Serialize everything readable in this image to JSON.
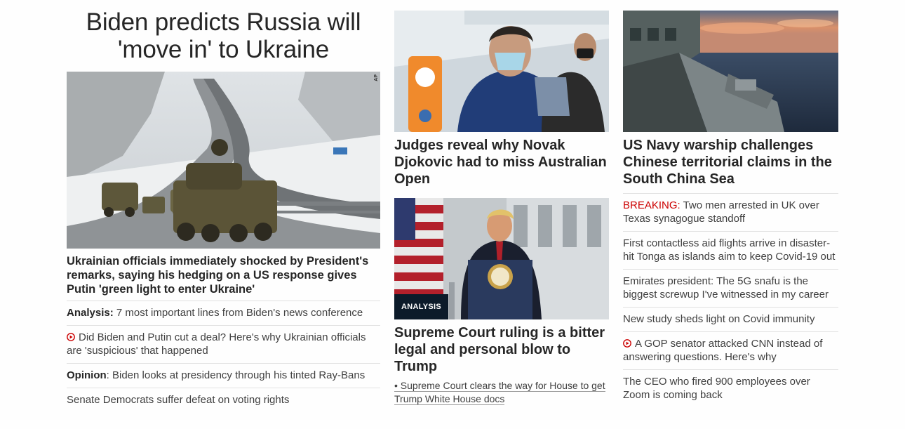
{
  "lead": {
    "title": "Biden predicts Russia will 'move in' to Ukraine",
    "image_credit": "AP",
    "caption": "Ukrainian officials immediately shocked by President's remarks, saying his hedging on a US response gives Putin 'green light to enter Ukraine'",
    "links": [
      {
        "prefix": "Analysis:",
        "text": " 7 most important lines from Biden's news conference",
        "icon": ""
      },
      {
        "prefix": "",
        "text": "Did Biden and Putin cut a deal? Here's why Ukrainian officials are 'suspicious' that happened",
        "icon": "play-icon"
      },
      {
        "prefix": "Opinion",
        "text": ": Biden looks at presidency through his tinted Ray-Bans",
        "icon": ""
      },
      {
        "prefix": "",
        "text": "Senate Democrats suffer defeat on voting rights",
        "icon": ""
      }
    ]
  },
  "middle": {
    "card1": {
      "title": "Judges reveal why Novak Djokovic had to miss Australian Open"
    },
    "card2": {
      "badge": "ANALYSIS",
      "title": "Supreme Court ruling is a bitter legal and personal blow to Trump",
      "sublink": "• Supreme Court clears the way for House to get Trump White House docs"
    }
  },
  "right": {
    "card": {
      "title": "US Navy warship challenges Chinese territorial claims in the South China Sea"
    },
    "links": [
      {
        "breaking": "BREAKING:",
        "text": " Two men arrested in UK over Texas synagogue standoff",
        "icon": ""
      },
      {
        "breaking": "",
        "text": "First contactless aid flights arrive in disaster-hit Tonga as islands aim to keep Covid-19 out",
        "icon": ""
      },
      {
        "breaking": "",
        "text": "Emirates president: The 5G snafu is the biggest screwup I've witnessed in my career",
        "icon": ""
      },
      {
        "breaking": "",
        "text": "New study sheds light on Covid immunity",
        "icon": ""
      },
      {
        "breaking": "",
        "text": "A GOP senator attacked CNN instead of answering questions. Here's why",
        "icon": "play-icon"
      },
      {
        "breaking": "",
        "text": "The CEO who fired 900 employees over Zoom is coming back",
        "icon": ""
      }
    ]
  },
  "colors": {
    "breaking": "#cc0000",
    "badge_bg": "#0c1b2a",
    "text": "#262626"
  }
}
